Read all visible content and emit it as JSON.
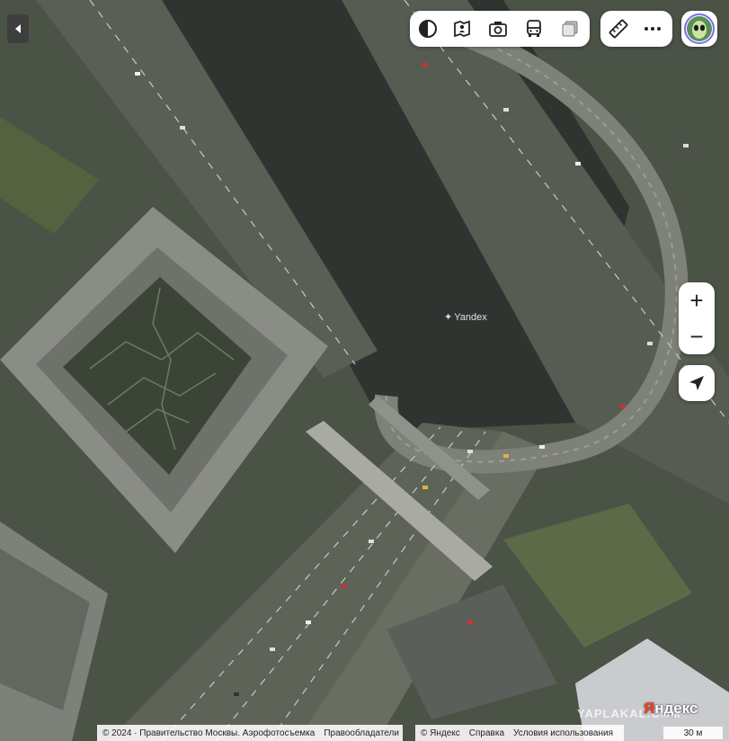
{
  "map": {
    "place_label": "Yandex",
    "watermark": "YAPLAKAL.COM",
    "logo_main": "ндекс",
    "logo_first": "Я"
  },
  "toolbar": {
    "items": [
      {
        "icon": "layers-icon"
      },
      {
        "icon": "panorama-icon"
      },
      {
        "icon": "camera-icon"
      },
      {
        "icon": "bus-icon"
      },
      {
        "icon": "map-layers-icon"
      }
    ],
    "tools": [
      {
        "icon": "ruler-icon"
      },
      {
        "icon": "more-icon"
      }
    ]
  },
  "controls": {
    "zoom_in": "+",
    "zoom_out": "−"
  },
  "footer": {
    "copyright": "© 2024 · Правительство Москвы. Аэрофотосъемка",
    "rights": "Правообладатели",
    "yandex": "© Яндекс",
    "help": "Справка",
    "terms": "Условия использования",
    "scale": "30 м"
  },
  "colors": {
    "accent": "#fc3f1d",
    "control_bg": "#ffffff"
  }
}
